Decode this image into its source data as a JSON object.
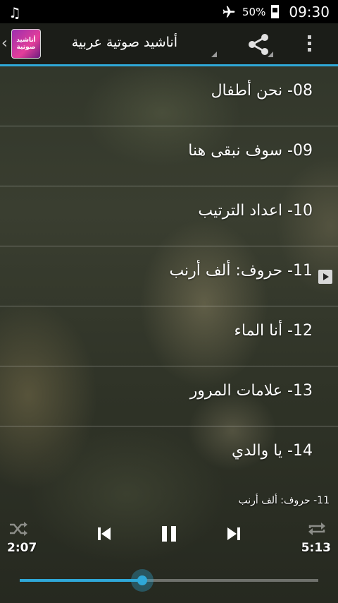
{
  "status": {
    "music_icon": "music-note-icon",
    "airplane_icon": "airplane-mode-icon",
    "battery": "50%",
    "battery_level": 0.5,
    "time": "09:30"
  },
  "actionbar": {
    "app_title": "أناشيد صوتية عربية",
    "logo_text": "أناشيد صوتية",
    "share_icon": "share-icon",
    "overflow_icon": "more-vert-icon",
    "accent": "#2fa8d8"
  },
  "tracks": [
    {
      "label": "08- نحن أطفال",
      "playing": false
    },
    {
      "label": "09- سوف نبقى هنا",
      "playing": false
    },
    {
      "label": "10- اعداد الترتيب",
      "playing": false
    },
    {
      "label": "11- حروف: ألف أرنب",
      "playing": true
    },
    {
      "label": "12- أنا الماء",
      "playing": false
    },
    {
      "label": "13- علامات المرور",
      "playing": false
    },
    {
      "label": "14- يا والدي",
      "playing": false
    }
  ],
  "player": {
    "now_playing": "11- حروف: ألف أرنب",
    "elapsed": "2:07",
    "duration": "5:13",
    "progress": 0.41
  }
}
